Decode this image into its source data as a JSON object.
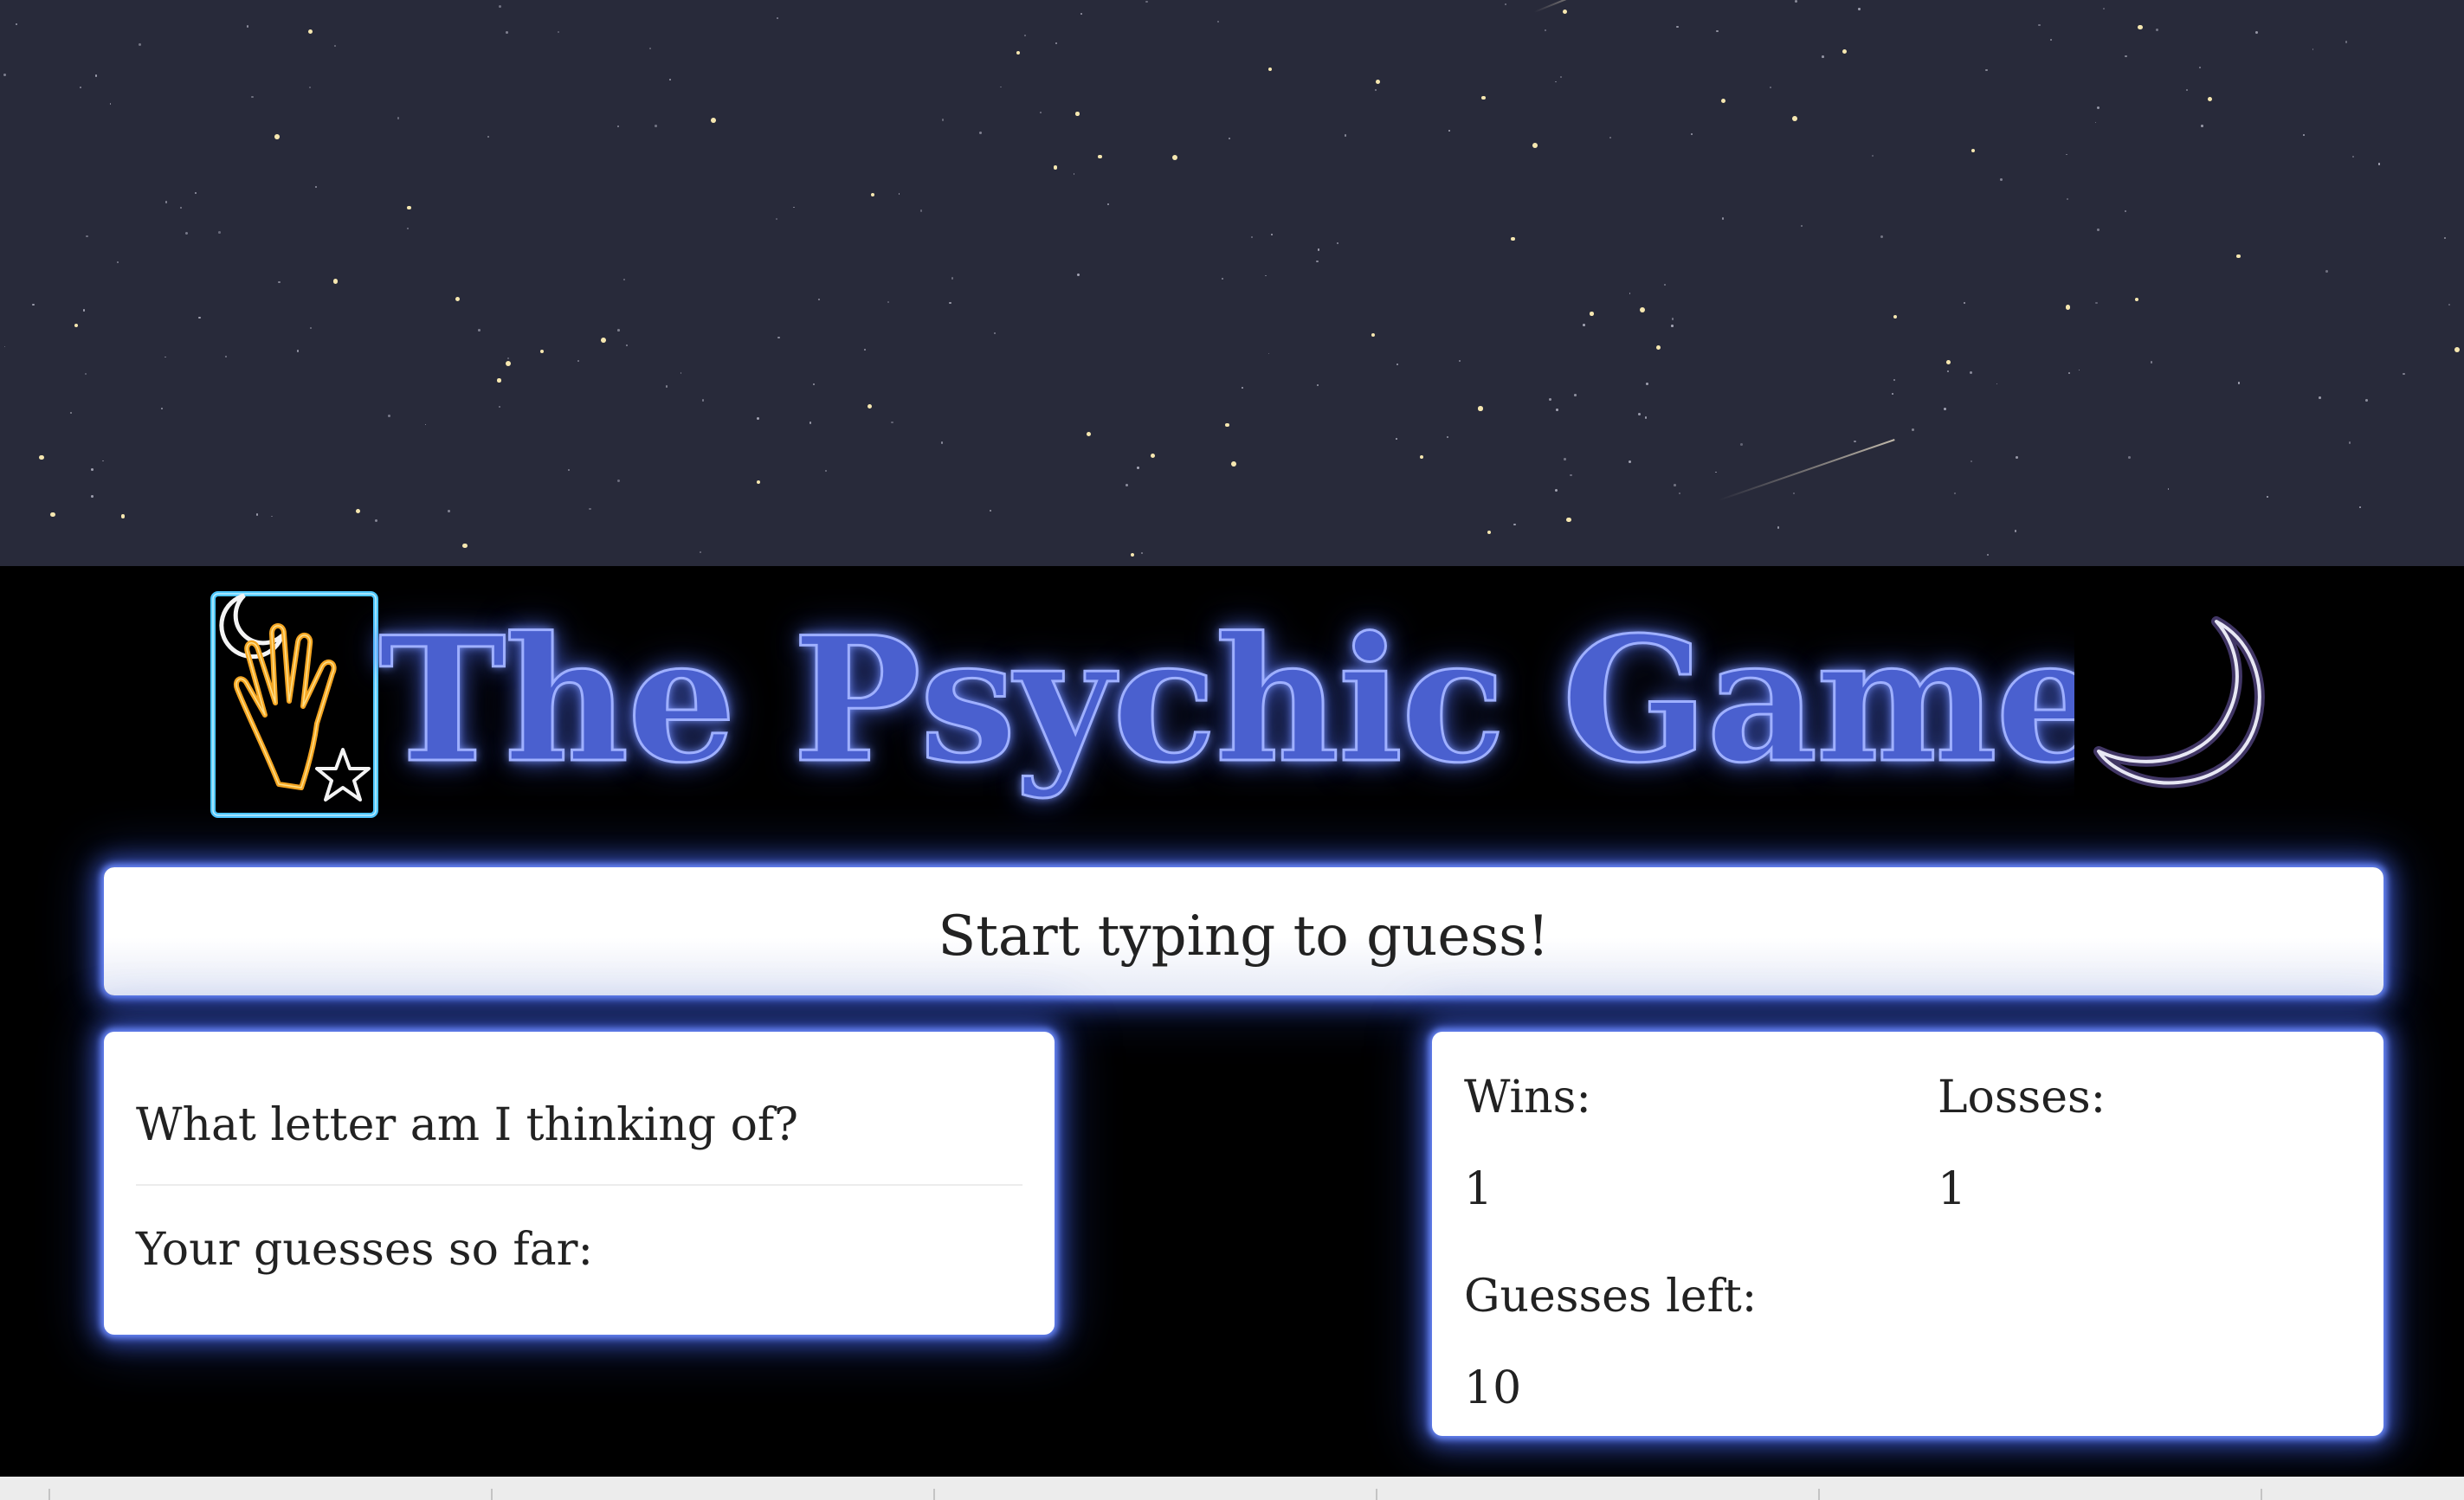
{
  "header": {
    "title": "The Psychic Game",
    "left_logo": "neon-palm-reading-sign",
    "right_logo": "neon-crescent-moon"
  },
  "banner": {
    "message": "Start typing to guess!"
  },
  "question_panel": {
    "question": "What letter am I thinking of?",
    "guesses_label": "Your guesses so far:",
    "guesses": ""
  },
  "score_panel": {
    "wins_label": "Wins:",
    "wins_value": "1",
    "losses_label": "Losses:",
    "losses_value": "1",
    "guesses_left_label": "Guesses left:",
    "guesses_left_value": "10"
  },
  "colors": {
    "sky": "#282a3a",
    "stage": "#000000",
    "title_fill": "#4a60cf",
    "glow": "#5a7cff",
    "panel": "#ffffff",
    "text": "#222222",
    "hand_neon": "#f5a623",
    "frame_neon": "#4fc8ff"
  }
}
